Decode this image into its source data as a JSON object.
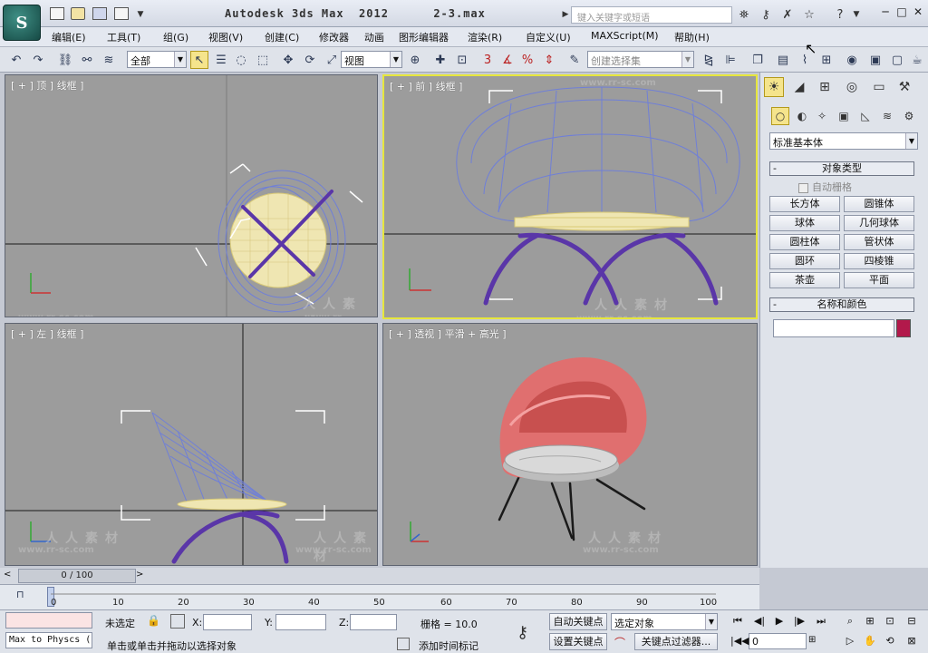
{
  "title": {
    "app_name": "Autodesk 3ds Max  2012",
    "file_name": "2-3.max",
    "search_placeholder": "键入关键字或短语"
  },
  "menu": [
    "编辑(E)",
    "工具(T)",
    "组(G)",
    "视图(V)",
    "创建(C)",
    "修改器",
    "动画",
    "图形编辑器",
    "渲染(R)",
    "自定义(U)",
    "MAXScript(M)",
    "帮助(H)"
  ],
  "toolbar": {
    "selection_filter": "全部",
    "reference_coord": "视图",
    "named_selection_placeholder": "创建选择集"
  },
  "viewports": {
    "top": "[ + ] 顶 ] 线框 ]",
    "front": "[ + ] 前 ] 线框 ]",
    "left": "[ + ] 左 ] 线框 ]",
    "perspective": "[ + ] 透视 ] 平滑 + 高光 ]"
  },
  "watermark": {
    "cn": "人人素材",
    "url": "www.rr-sc.com"
  },
  "command_panel": {
    "category": "标准基本体",
    "object_type_title": "对象类型",
    "auto_grid": "自动栅格",
    "buttons": [
      "长方体",
      "圆锥体",
      "球体",
      "几何球体",
      "圆柱体",
      "管状体",
      "圆环",
      "四棱锥",
      "茶壶",
      "平面"
    ],
    "name_color_title": "名称和颜色",
    "object_color": "#b2194b"
  },
  "timeline": {
    "frame_display": "0 / 100",
    "ticks": [
      "0",
      "10",
      "20",
      "30",
      "40",
      "50",
      "60",
      "70",
      "80",
      "90",
      "100"
    ]
  },
  "status": {
    "maxscript_listener": "Max to Physcs (",
    "selection_status": "未选定",
    "prompt": "单击或单击并拖动以选择对象",
    "x_label": "X:",
    "y_label": "Y:",
    "z_label": "Z:",
    "grid": "栅格 = 10.0",
    "add_time_tag": "添加时间标记",
    "auto_key": "自动关键点",
    "set_key": "设置关键点",
    "key_mode": "选定对象",
    "key_filters": "关键点过滤器...",
    "current_frame": "0"
  }
}
